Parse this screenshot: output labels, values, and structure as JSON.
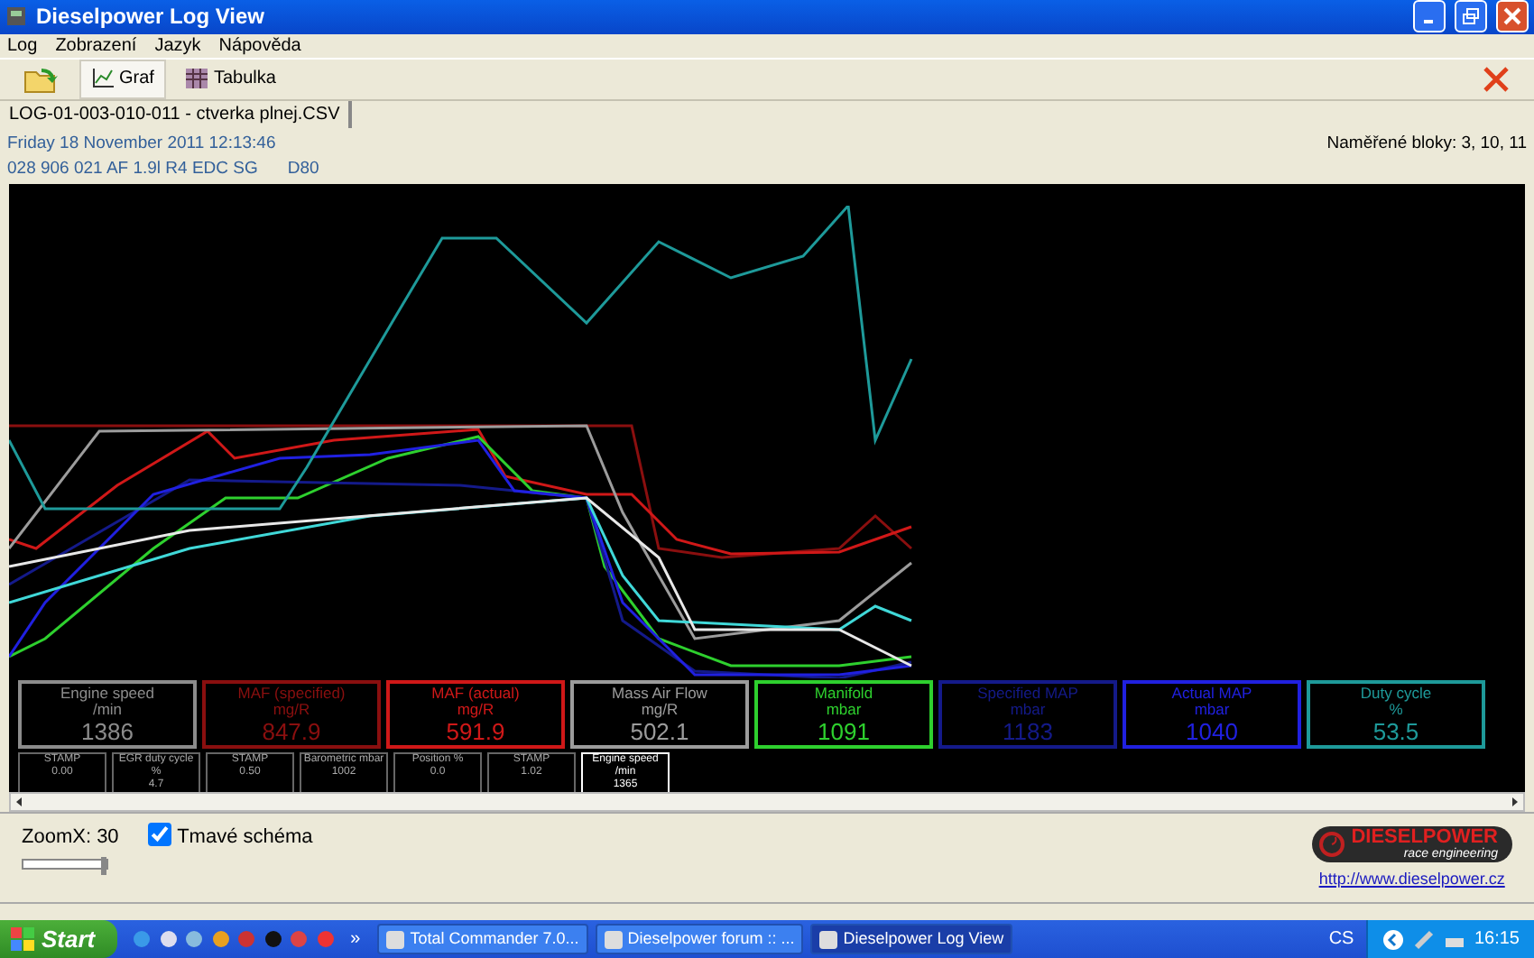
{
  "window": {
    "title": "Dieselpower Log View"
  },
  "menu": [
    "Log",
    "Zobrazení",
    "Jazyk",
    "Nápověda"
  ],
  "toolbar": [
    {
      "label": "Graf",
      "selected": true
    },
    {
      "label": "Tabulka",
      "selected": false
    }
  ],
  "document_tab": "LOG-01-003-010-011 - ctverka plnej.CSV",
  "info": {
    "date": "Friday 18 November 2011 12:13:46",
    "engine": "028 906 021 AF  1.9l R4 EDC SG",
    "code": "D80",
    "blocks": "Naměřené bloky: 3, 10, 11"
  },
  "gauges": [
    {
      "title": "Engine speed",
      "unit": "/min",
      "value": "1386",
      "color": "#8c8c8c"
    },
    {
      "title": "MAF (specified)",
      "unit": "mg/R",
      "value": "847.9",
      "color": "#8a0f0f"
    },
    {
      "title": "MAF (actual)",
      "unit": "mg/R",
      "value": "591.9",
      "color": "#d01818"
    },
    {
      "title": "Mass Air Flow",
      "unit": "mg/R",
      "value": "502.1",
      "color": "#9c9c9c"
    },
    {
      "title": "Manifold",
      "unit": "mbar",
      "value": "1091",
      "color": "#2ed02e"
    },
    {
      "title": "Specified MAP",
      "unit": "mbar",
      "value": "1183",
      "color": "#141a8a"
    },
    {
      "title": "Actual MAP",
      "unit": "mbar",
      "value": "1040",
      "color": "#2020e0"
    },
    {
      "title": "Duty cycle",
      "unit": "%",
      "value": "53.5",
      "color": "#1e9a9a"
    }
  ],
  "stamps": [
    {
      "label": "STAMP",
      "value": "0.00",
      "selected": false
    },
    {
      "label": "EGR duty cycle %",
      "value": "4.7",
      "selected": false
    },
    {
      "label": "STAMP",
      "value": "0.50",
      "selected": false
    },
    {
      "label": "Barometric mbar",
      "value": "1002",
      "selected": false
    },
    {
      "label": "Position %",
      "value": "0.0",
      "selected": false
    },
    {
      "label": "STAMP",
      "value": "1.02",
      "selected": false
    },
    {
      "label": "Engine speed /min",
      "value": "1365",
      "selected": true
    }
  ],
  "zoom": {
    "label": "ZoomX: 30",
    "level": 1
  },
  "dark_scheme": {
    "label": "Tmavé schéma",
    "checked": true
  },
  "logo": {
    "name": "DIESELPOWER",
    "tagline": "race engineering"
  },
  "website": "http://www.dieselpower.cz",
  "taskbar": {
    "start": "Start",
    "more": "»",
    "tasks": [
      {
        "label": "Total Commander 7.0...",
        "selected": false
      },
      {
        "label": "Dieselpower forum :: ...",
        "selected": false
      },
      {
        "label": "Dieselpower Log View",
        "selected": true
      }
    ],
    "language": "CS",
    "time": "16:15"
  }
}
